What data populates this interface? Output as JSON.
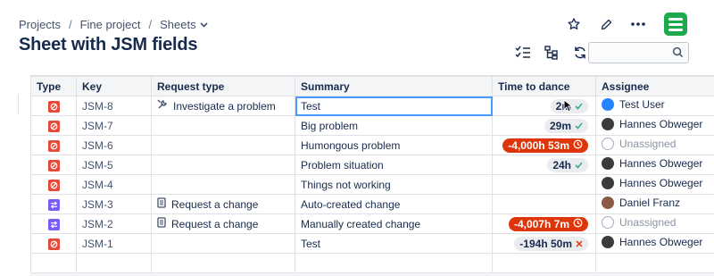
{
  "breadcrumb": {
    "items": [
      "Projects",
      "Fine project",
      "Sheets"
    ]
  },
  "page": {
    "title": "Sheet with JSM fields"
  },
  "search": {
    "placeholder": ""
  },
  "columns": [
    "Type",
    "Key",
    "Request type",
    "Summary",
    "Time to dance",
    "Assignee"
  ],
  "rows": [
    {
      "type": "problem",
      "key": "JSM-8",
      "request_type": "Investigate a problem",
      "request_icon": "wrench-icon",
      "summary": "Test",
      "sla": "2m",
      "sla_state": "ok",
      "assignee": "Test User",
      "avatar": "test"
    },
    {
      "type": "problem",
      "key": "JSM-7",
      "request_type": "",
      "request_icon": "",
      "summary": "Big problem",
      "sla": "29m",
      "sla_state": "ok",
      "assignee": "Hannes Obweger",
      "avatar": "hannes"
    },
    {
      "type": "problem",
      "key": "JSM-6",
      "request_type": "",
      "request_icon": "",
      "summary": "Humongous problem",
      "sla": "-4,000h 53m",
      "sla_state": "late",
      "assignee": "Unassigned",
      "avatar": "un"
    },
    {
      "type": "problem",
      "key": "JSM-5",
      "request_type": "",
      "request_icon": "",
      "summary": "Problem situation",
      "sla": "24h",
      "sla_state": "ok",
      "assignee": "Hannes Obweger",
      "avatar": "hannes"
    },
    {
      "type": "problem",
      "key": "JSM-4",
      "request_type": "",
      "request_icon": "",
      "summary": "Things not working",
      "sla": "",
      "sla_state": "",
      "assignee": "Hannes Obweger",
      "avatar": "hannes"
    },
    {
      "type": "change",
      "key": "JSM-3",
      "request_type": "Request a change",
      "request_icon": "document-icon",
      "summary": "Auto-created change",
      "sla": "",
      "sla_state": "",
      "assignee": "Daniel Franz",
      "avatar": "daniel"
    },
    {
      "type": "change",
      "key": "JSM-2",
      "request_type": "Request a change",
      "request_icon": "document-icon",
      "summary": "Manually created change",
      "sla": "-4,007h 7m",
      "sla_state": "late",
      "assignee": "Unassigned",
      "avatar": "un"
    },
    {
      "type": "problem",
      "key": "JSM-1",
      "request_type": "",
      "request_icon": "",
      "summary": "Test",
      "sla": "-194h 50m",
      "sla_state": "miss",
      "assignee": "Hannes Obweger",
      "avatar": "hannes"
    }
  ],
  "colors": {
    "problem": "#e5493a",
    "change": "#7a5af8",
    "late": "#de350b",
    "accent": "#4c9aff",
    "logo": "#1fa94d"
  }
}
